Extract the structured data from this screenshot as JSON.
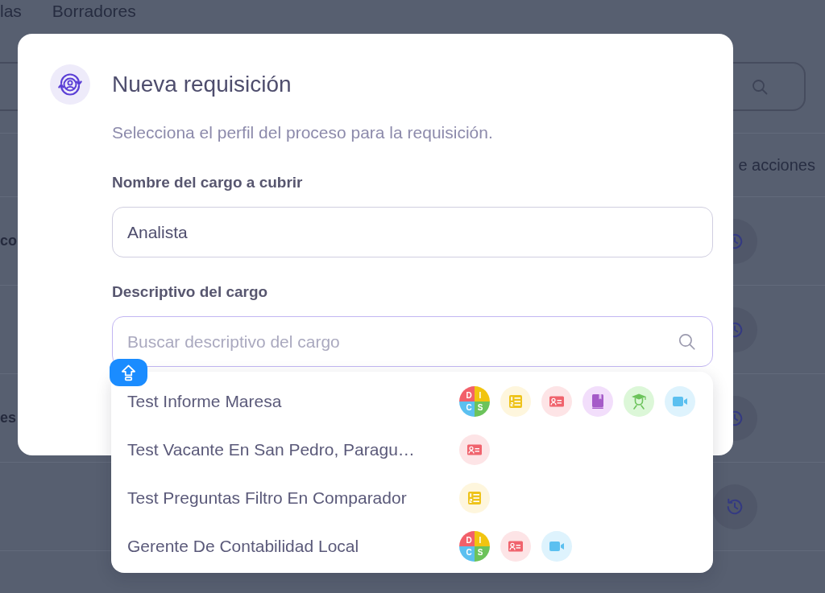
{
  "background_page": {
    "tabs": [
      {
        "label": "las",
        "selected": false
      },
      {
        "label": "Borradores",
        "selected": false
      }
    ],
    "table": {
      "header": "e acciones",
      "rows": [
        {
          "column_1": "co"
        },
        {},
        {
          "column_1": "es"
        },
        {}
      ]
    }
  },
  "modal": {
    "title": "Nueva requisición",
    "subtitle": "Selecciona el perfil del proceso para la requisición.",
    "fields": [
      {
        "kind": "text",
        "label": "Nombre del cargo a cubrir",
        "value": "Analista",
        "focused": false
      },
      {
        "kind": "search",
        "label": "Descriptivo del cargo",
        "placeholder": "Buscar descriptivo del cargo",
        "focused": true
      }
    ],
    "dropdown": {
      "items": [
        {
          "label": "Test Informe Maresa",
          "selected": false,
          "tests": [
            {
              "kind": "disc",
              "letters": [
                "D",
                "I",
                "C",
                "S"
              ]
            },
            {
              "kind": "list"
            },
            {
              "kind": "id-card"
            },
            {
              "kind": "book"
            },
            {
              "kind": "graduate"
            },
            {
              "kind": "video"
            }
          ]
        },
        {
          "label": "Test Vacante En San Pedro, Paragu…",
          "selected": false,
          "tests": [
            {
              "kind": "id-card"
            }
          ]
        },
        {
          "label": "Test Preguntas Filtro En Comparador",
          "selected": false,
          "tests": [
            {
              "kind": "list"
            }
          ]
        },
        {
          "label": "Gerente De Contabilidad Local",
          "selected": false,
          "tests": [
            {
              "kind": "disc",
              "letters": [
                "D",
                "I",
                "C",
                "S"
              ]
            },
            {
              "kind": "id-card"
            },
            {
              "kind": "video"
            }
          ]
        }
      ]
    }
  }
}
